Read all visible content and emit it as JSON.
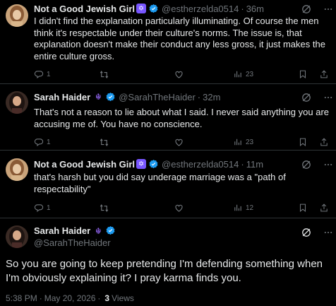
{
  "colors": {
    "background": "#000000",
    "text": "#e7e9ea",
    "muted": "#71767b",
    "verified": "#1d9bf0",
    "emoji_bg": "#7856ff"
  },
  "tweets": [
    {
      "name": "Not a Good Jewish Girl",
      "emoji": "✡",
      "handle": "@estherzelda0514",
      "dot": "·",
      "time": "36m",
      "text": "I didn't find the explanation particularly illuminating. Of course the men think it's respectable under their culture's norms. The issue is, that explanation doesn't make their conduct any less gross, it just makes the entire culture gross.",
      "replies": "1",
      "views": "23"
    },
    {
      "name": "Sarah Haider",
      "emoji": "☬",
      "handle": "@SarahTheHaider",
      "dot": "·",
      "time": "32m",
      "text": "That's not a reason to lie about what I said. I never said anything you are accusing me of. You have no conscience.",
      "replies": "1",
      "views": "23"
    },
    {
      "name": "Not a Good Jewish Girl",
      "emoji": "✡",
      "handle": "@estherzelda0514",
      "dot": "·",
      "time": "11m",
      "text": "that's harsh but you did say underage marriage was a \"path of respectability\"",
      "replies": "1",
      "views": "12"
    }
  ],
  "main": {
    "name": "Sarah Haider",
    "emoji": "☬",
    "handle": "@SarahTheHaider",
    "text": "So you are going to keep pretending I'm defending something when I'm obviously explaining it? I pray karma finds you.",
    "time": "5:38 PM",
    "dot": "·",
    "date": "May 20, 2026",
    "views_count": "3",
    "views_label": "Views"
  }
}
